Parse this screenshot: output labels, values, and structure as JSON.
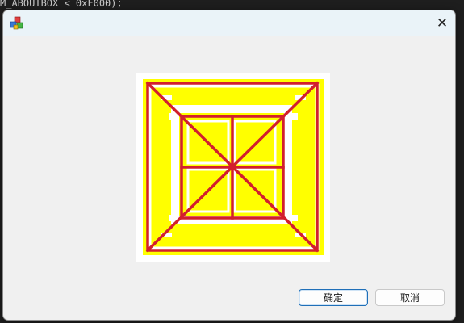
{
  "background": {
    "code_top": "M_ABOUTBOX < 0xF000);",
    "code_bottom": ""
  },
  "dialog": {
    "title": "",
    "close_glyph": "✕",
    "buttons": {
      "ok_label": "确定",
      "cancel_label": "取消"
    }
  },
  "colors": {
    "picture_fill": "#ffff00",
    "picture_lines": "#d21f2d",
    "accent_border": "#1f6fb8"
  },
  "icons": {
    "app": "mfc-app-icon",
    "close": "close-icon"
  }
}
